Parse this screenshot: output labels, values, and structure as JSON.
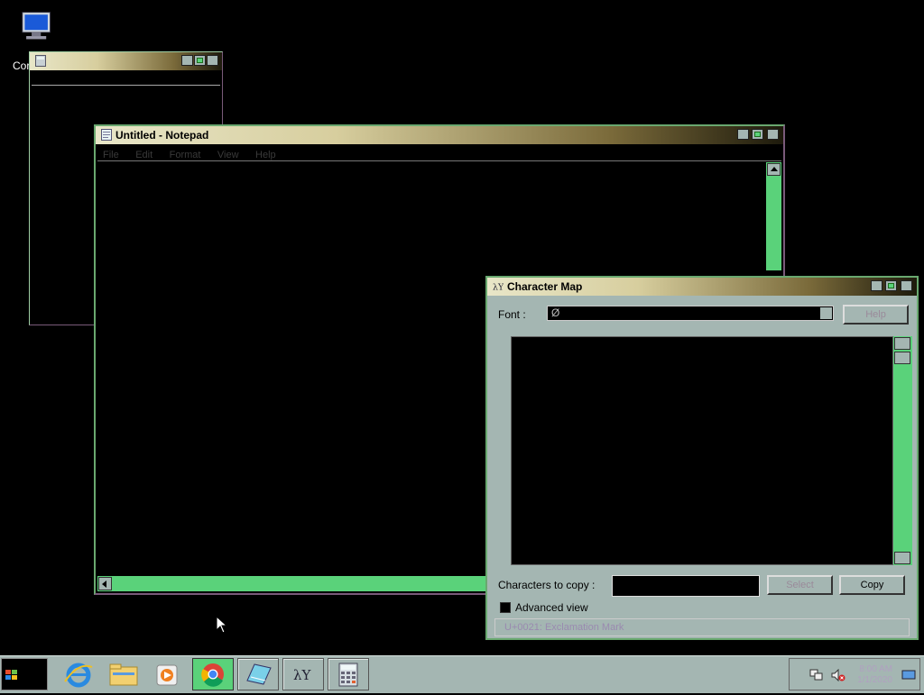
{
  "desktop": {
    "icon_label": "Cor"
  },
  "notepad": {
    "title": "Untitled - Notepad",
    "menu": [
      "File",
      "Edit",
      "Format",
      "View",
      "Help"
    ]
  },
  "charmap": {
    "title": "Character Map",
    "font_label": "Font :",
    "font_value": "Ø",
    "help_label": "Help",
    "chars_to_copy_label": "Characters to copy :",
    "select_label": "Select",
    "copy_label": "Copy",
    "advanced_view_label": "Advanced view",
    "status_text": "U+0021: Exclamation Mark"
  },
  "taskbar": {
    "items": [
      "start",
      "internet-explorer",
      "file-explorer",
      "media-player",
      "chrome",
      "notepad",
      "character-map",
      "calculator"
    ],
    "clock_time": "8:00 AM",
    "clock_date": "1/1/2020"
  },
  "colors": {
    "window_face": "#a4b6b2",
    "accent_green": "#5ad27a",
    "title_gradient_start": "#e8e6c8",
    "title_gradient_end": "#1d1a0c"
  }
}
